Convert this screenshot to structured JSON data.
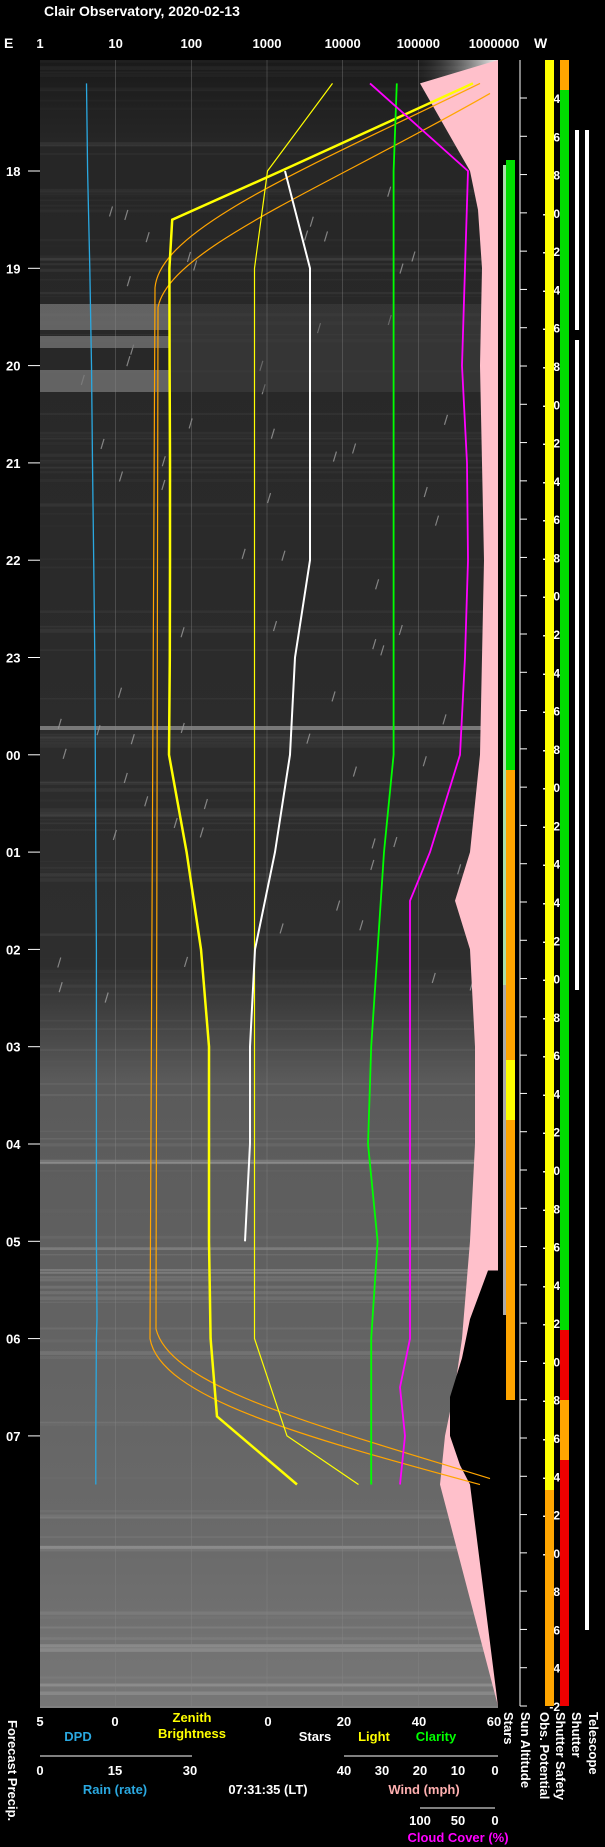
{
  "title": "Clair Observatory, 2020-02-13",
  "top_axis": {
    "left_end": "E",
    "right_end": "W",
    "ticks": [
      "1",
      "10",
      "100",
      "1000",
      "10000",
      "100000",
      "1000000"
    ]
  },
  "time_ticks": [
    "18",
    "19",
    "20",
    "21",
    "22",
    "23",
    "00",
    "01",
    "02",
    "03",
    "04",
    "05",
    "06",
    "07"
  ],
  "sun_altitude_ticks": [
    "-4",
    "-6",
    "-8",
    "-10",
    "-12",
    "-14",
    "-16",
    "-18",
    "-20",
    "-22",
    "-24",
    "-26",
    "-28",
    "-30",
    "-32",
    "-34",
    "-36",
    "-38",
    "-40",
    "-42",
    "-44",
    "-44",
    "-42",
    "-40",
    "-38",
    "-36",
    "-34",
    "-32",
    "-30",
    "-28",
    "-26",
    "-24",
    "-22",
    "-20",
    "-18",
    "-16",
    "-14",
    "-12",
    "-10",
    "-8",
    "-6",
    "-4",
    "-2"
  ],
  "bottom_axes": {
    "row1": [
      {
        "value": "5"
      },
      {
        "value": "0"
      },
      {
        "value": "0"
      },
      {
        "value": "20"
      },
      {
        "value": "40"
      },
      {
        "value": "60"
      }
    ],
    "row1_labels": {
      "dpd": "DPD",
      "zenith1": "Zenith",
      "zenith2": "Brightness",
      "stars": "Stars",
      "light": "Light",
      "clarity": "Clarity"
    },
    "row2": [
      {
        "value": "0"
      },
      {
        "value": "15"
      },
      {
        "value": "30"
      },
      {
        "value": "40"
      },
      {
        "value": "30"
      },
      {
        "value": "20"
      },
      {
        "value": "10"
      },
      {
        "value": "0"
      }
    ],
    "row2_labels": {
      "rain": "Rain (rate)",
      "time": "07:31:35 (LT)",
      "wind": "Wind (mph)"
    },
    "row3": [
      {
        "value": "100"
      },
      {
        "value": "50"
      },
      {
        "value": "0"
      }
    ],
    "cloud_label": "Cloud Cover (%)"
  },
  "vertical_labels": {
    "forecast": "Forecast Precip.",
    "stars": "Stars",
    "sun_altitude": "Sun Altitude",
    "obs_potential": "Obs. Potential",
    "shutter_safety": "Shutter Safety",
    "shutter": "Shutter",
    "telescope": "Telescope"
  },
  "colors": {
    "dpd": "#2aa8e0",
    "zenith": "#ffff00",
    "stars": "#ffffff",
    "light": "#ffff00",
    "clarity": "#00ff00",
    "cloud": "#ff00ff",
    "rain": "#2aa8e0",
    "wind": "#ffb0b0",
    "sun_curve": "#ffa500",
    "sun_band": "#ffc0cb",
    "good": "#00dd00",
    "caution": "#ffa500",
    "bad": "#ee0000",
    "warn": "#ffff00"
  },
  "chart_data": {
    "type": "line",
    "title": "Clair Observatory, 2020-02-13",
    "x_axis": "local time (hours)",
    "time_range": [
      "17:05",
      "07:31"
    ],
    "series": [
      {
        "name": "DPD",
        "values_hour_x": [
          [
            17.1,
            3.0
          ],
          [
            18.0,
            3.2
          ],
          [
            19.0,
            3.6
          ],
          [
            20.0,
            3.9
          ],
          [
            21.0,
            4.1
          ],
          [
            22.0,
            4.3
          ],
          [
            23.0,
            4.5
          ],
          [
            0.0,
            4.6
          ],
          [
            1.0,
            4.7
          ],
          [
            2.0,
            4.8
          ],
          [
            3.0,
            4.8
          ],
          [
            4.0,
            4.8
          ],
          [
            5.0,
            4.8
          ],
          [
            5.8,
            4.9
          ],
          [
            6.0,
            4.8
          ],
          [
            7.0,
            4.7
          ],
          [
            7.5,
            4.7
          ]
        ]
      },
      {
        "name": "Zenith Brightness",
        "values_hour_x": [
          [
            17.1,
            20
          ],
          [
            18.0,
            8
          ],
          [
            18.5,
            1.2
          ],
          [
            19.0,
            0.8
          ],
          [
            20.0,
            0.7
          ],
          [
            21.0,
            0.5
          ],
          [
            22.0,
            0.5
          ],
          [
            23.0,
            0.6
          ],
          [
            0.0,
            1.0
          ],
          [
            1.0,
            2.1
          ],
          [
            2.0,
            3.0
          ],
          [
            3.0,
            3.5
          ],
          [
            4.0,
            3.5
          ],
          [
            5.0,
            3.5
          ],
          [
            6.0,
            3.6
          ],
          [
            6.8,
            4.0
          ],
          [
            7.5,
            9.0
          ]
        ]
      },
      {
        "name": "Stars",
        "values_hour_x": [
          [
            18.0,
            9
          ],
          [
            19.0,
            14
          ],
          [
            20.0,
            14
          ],
          [
            21.0,
            14
          ],
          [
            22.0,
            14
          ],
          [
            23.0,
            11
          ],
          [
            0.0,
            10
          ],
          [
            1.0,
            7
          ],
          [
            2.0,
            3
          ],
          [
            3.0,
            2
          ],
          [
            4.0,
            2
          ],
          [
            5.0,
            1
          ]
        ]
      },
      {
        "name": "Light",
        "values_hour_x": [
          [
            17.1,
            45
          ],
          [
            18.0,
            35
          ],
          [
            19.0,
            33
          ],
          [
            20.0,
            33
          ],
          [
            22.0,
            33
          ],
          [
            0.0,
            33
          ],
          [
            1.0,
            33
          ],
          [
            2.0,
            33
          ],
          [
            3.0,
            33
          ],
          [
            6.0,
            33
          ],
          [
            7.0,
            38
          ],
          [
            7.5,
            49
          ]
        ]
      },
      {
        "name": "Clarity",
        "values_hour_x": [
          [
            17.1,
            24
          ],
          [
            18.0,
            23
          ],
          [
            19.0,
            23
          ],
          [
            20.0,
            23
          ],
          [
            21.0,
            23
          ],
          [
            22.0,
            23
          ],
          [
            23.0,
            23
          ],
          [
            0.0,
            23
          ],
          [
            1.0,
            20
          ],
          [
            2.0,
            18
          ],
          [
            3.0,
            16
          ],
          [
            4.0,
            15
          ],
          [
            5.0,
            18
          ],
          [
            6.0,
            16
          ],
          [
            7.0,
            16
          ],
          [
            7.5,
            16
          ]
        ]
      },
      {
        "name": "Cloud Cover (%)",
        "values_hour_x": [
          [
            17.1,
            100
          ],
          [
            18.0,
            2
          ],
          [
            19.0,
            5
          ],
          [
            20.0,
            8
          ],
          [
            21.0,
            3
          ],
          [
            22.0,
            2
          ],
          [
            23.0,
            5
          ],
          [
            0.0,
            10
          ],
          [
            1.0,
            40
          ],
          [
            1.5,
            60
          ],
          [
            2.0,
            60
          ],
          [
            3.0,
            60
          ],
          [
            4.0,
            60
          ],
          [
            5.0,
            60
          ],
          [
            6.0,
            60
          ],
          [
            6.5,
            70
          ],
          [
            7.0,
            65
          ],
          [
            7.5,
            70
          ]
        ]
      }
    ]
  }
}
